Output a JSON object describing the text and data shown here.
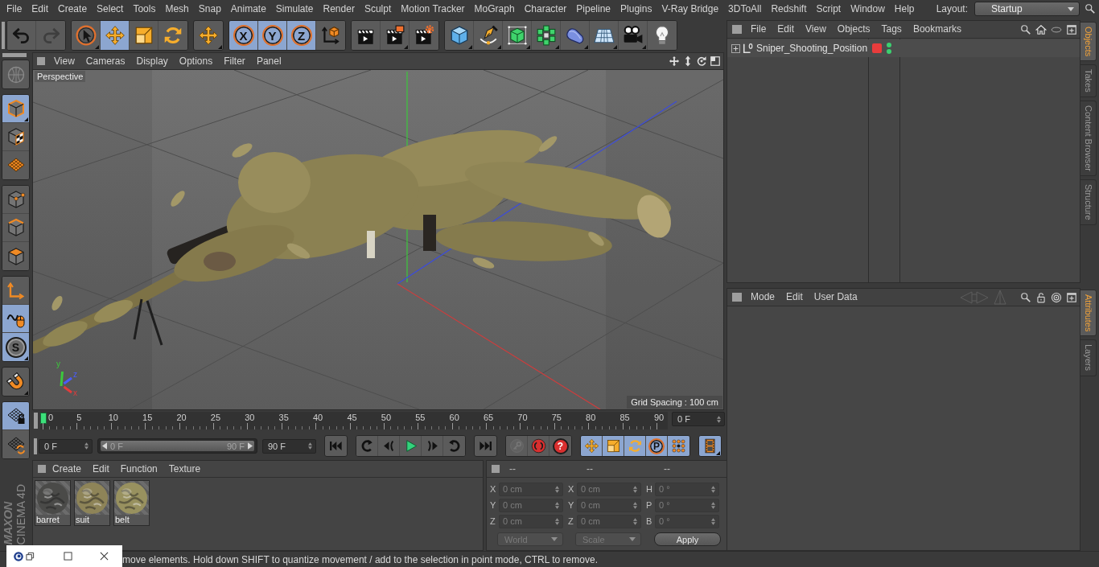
{
  "menu_bar": {
    "items": [
      "File",
      "Edit",
      "Create",
      "Select",
      "Tools",
      "Mesh",
      "Snap",
      "Animate",
      "Simulate",
      "Render",
      "Sculpt",
      "Motion Tracker",
      "MoGraph",
      "Character",
      "Pipeline",
      "Plugins",
      "V-Ray Bridge",
      "3DToAll",
      "Redshift",
      "Script",
      "Window",
      "Help"
    ],
    "layout_label": "Layout:",
    "layout_value": "Startup"
  },
  "toolbar": [
    {
      "buttons": [
        {
          "kind": "undo",
          "selected": false,
          "disabled": false
        },
        {
          "kind": "redo",
          "selected": false,
          "disabled": true
        }
      ]
    },
    {
      "buttons": [
        {
          "kind": "select",
          "selected": false
        },
        {
          "kind": "move",
          "selected": true
        },
        {
          "kind": "scale",
          "selected": false
        },
        {
          "kind": "rotate",
          "selected": false
        }
      ]
    },
    {
      "buttons": [
        {
          "kind": "recent",
          "selected": false
        }
      ]
    },
    {
      "buttons": [
        {
          "kind": "xaxis",
          "label": "X",
          "selected": true
        },
        {
          "kind": "yaxis",
          "label": "Y",
          "selected": true
        },
        {
          "kind": "zaxis",
          "label": "Z",
          "selected": true
        },
        {
          "kind": "coord",
          "selected": false
        }
      ]
    },
    {
      "buttons": [
        {
          "kind": "renderview",
          "selected": false
        },
        {
          "kind": "renderpic",
          "selected": false
        },
        {
          "kind": "rendersettings",
          "selected": false
        }
      ]
    },
    {
      "buttons": [
        {
          "kind": "cube",
          "selected": false
        },
        {
          "kind": "pen",
          "selected": false
        },
        {
          "kind": "subdiv",
          "selected": false
        },
        {
          "kind": "cloner",
          "selected": false
        },
        {
          "kind": "deformer",
          "selected": false
        },
        {
          "kind": "floor",
          "selected": false
        },
        {
          "kind": "camera",
          "selected": false
        },
        {
          "kind": "light",
          "selected": false
        }
      ]
    }
  ],
  "mode_toolbar": [
    {
      "buttons": [
        {
          "kind": "editable",
          "selected": false,
          "disabled": true
        }
      ]
    },
    {
      "buttons": [
        {
          "kind": "model",
          "selected": true
        },
        {
          "kind": "texture",
          "selected": false
        },
        {
          "kind": "workplane",
          "selected": false
        }
      ]
    },
    {
      "buttons": [
        {
          "kind": "points",
          "selected": false
        },
        {
          "kind": "edges",
          "selected": false
        },
        {
          "kind": "polygons",
          "selected": false
        }
      ]
    },
    {
      "buttons": [
        {
          "kind": "axis",
          "selected": false
        },
        {
          "kind": "tweak",
          "selected": true
        },
        {
          "kind": "solo",
          "label": "S",
          "selected": true
        }
      ]
    },
    {
      "buttons": [
        {
          "kind": "magnet",
          "selected": false
        }
      ]
    },
    {
      "buttons": [
        {
          "kind": "lockwp",
          "selected": true
        },
        {
          "kind": "gridrefresh",
          "selected": false
        }
      ]
    }
  ],
  "logo": {
    "brand": "MAXON",
    "product": "CINEMA 4D"
  },
  "viewport": {
    "menu": [
      "View",
      "Cameras",
      "Display",
      "Options",
      "Filter",
      "Panel"
    ],
    "camera": "Perspective",
    "grid_spacing": "Grid Spacing : 100 cm",
    "axes": [
      {
        "label": "y",
        "color": "#3cc83c"
      },
      {
        "label": "z",
        "color": "#4a5cff"
      },
      {
        "label": "x",
        "color": "#e03c3c"
      }
    ]
  },
  "timeline": {
    "labels": [
      "0",
      "5",
      "10",
      "15",
      "20",
      "25",
      "30",
      "35",
      "40",
      "45",
      "50",
      "55",
      "60",
      "65",
      "70",
      "75",
      "80",
      "85",
      "90"
    ],
    "level": 0,
    "frame_field": "0 F"
  },
  "transport": {
    "start_field": "0 F",
    "range": {
      "start": "0 F",
      "end": "90 F",
      "level": 1
    },
    "end_field": "90 F",
    "groups": [
      {
        "buttons": [
          {
            "kind": "gostart",
            "selected": false
          }
        ]
      },
      {
        "buttons": [
          {
            "kind": "prevkey",
            "selected": false
          },
          {
            "kind": "prevframe",
            "selected": false
          },
          {
            "kind": "play",
            "selected": false
          },
          {
            "kind": "nextframe",
            "selected": false
          },
          {
            "kind": "nextkey",
            "selected": false
          }
        ]
      },
      {
        "buttons": [
          {
            "kind": "goend",
            "selected": false
          }
        ]
      },
      {
        "buttons": [
          {
            "kind": "key",
            "selected": false,
            "disabled": true
          },
          {
            "kind": "record",
            "selected": false,
            "disabled": false
          },
          {
            "kind": "autokey",
            "label": "?",
            "selected": false,
            "disabled": false
          }
        ]
      },
      {
        "buttons": [
          {
            "kind": "movekey",
            "selected": true
          },
          {
            "kind": "scalekey",
            "selected": true
          },
          {
            "kind": "rotatekey",
            "selected": true
          },
          {
            "kind": "paramkey",
            "label": "P",
            "selected": true
          },
          {
            "kind": "plakey",
            "selected": true
          }
        ]
      },
      {
        "buttons": [
          {
            "kind": "film",
            "selected": true
          }
        ]
      }
    ]
  },
  "materials": {
    "menu": [
      "Create",
      "Edit",
      "Function",
      "Texture"
    ],
    "items": [
      {
        "name": "barret",
        "color": "#4a4a48"
      },
      {
        "name": "suit",
        "color": "#8e8458"
      },
      {
        "name": "belt",
        "color": "#98915f"
      }
    ]
  },
  "coordinates": {
    "headers": [
      "--",
      "--",
      "--"
    ],
    "rows": [
      [
        {
          "axis": "X",
          "value": "0 cm"
        },
        {
          "axis": "X",
          "value": "0 cm"
        },
        {
          "axis": "H",
          "value": "0 °"
        }
      ],
      [
        {
          "axis": "Y",
          "value": "0 cm"
        },
        {
          "axis": "Y",
          "value": "0 cm"
        },
        {
          "axis": "P",
          "value": "0 °"
        }
      ],
      [
        {
          "axis": "Z",
          "value": "0 cm"
        },
        {
          "axis": "Z",
          "value": "0 cm"
        },
        {
          "axis": "B",
          "value": "0 °"
        }
      ]
    ],
    "dropdowns": [
      {
        "value": "World",
        "disabled": true
      },
      {
        "value": "Scale",
        "disabled": true
      }
    ],
    "apply": "Apply"
  },
  "object_manager": {
    "menu": [
      "File",
      "Edit",
      "View",
      "Objects",
      "Tags",
      "Bookmarks"
    ],
    "objects": [
      {
        "name": "Sniper_Shooting_Position",
        "expanded": false,
        "color": "#e83c3c",
        "editor_visible": true,
        "render_visible": true
      }
    ]
  },
  "attribute_manager": {
    "menu": [
      "Mode",
      "Edit",
      "User Data"
    ]
  },
  "side_tabs": {
    "top": [
      {
        "label": "Objects",
        "selected": true
      },
      {
        "label": "Takes",
        "selected": false
      },
      {
        "label": "Content Browser",
        "selected": false
      },
      {
        "label": "Structure",
        "selected": false
      }
    ],
    "bottom": [
      {
        "label": "Attributes",
        "selected": true
      },
      {
        "label": "Layers",
        "selected": false
      }
    ]
  },
  "status_bar": {
    "text": "move elements. Hold down SHIFT to quantize movement / add to the selection in point mode, CTRL to remove."
  }
}
